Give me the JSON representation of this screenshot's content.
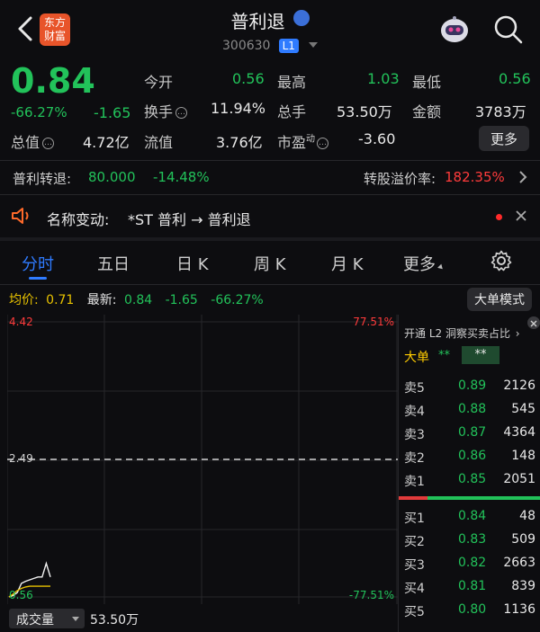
{
  "header": {
    "stock_name": "普利退",
    "badge_icon": "shield-badge-icon",
    "stock_code": "300630",
    "level_badge": "L1",
    "app_logo_line1": "东方",
    "app_logo_line2": "财富",
    "robot_icon": "robot-assistant-icon",
    "search_icon": "search-icon"
  },
  "quote": {
    "price": "0.84",
    "change_pct": "-66.27%",
    "change": "-1.65",
    "open_label": "今开",
    "open": "0.56",
    "high_label": "最高",
    "high": "1.03",
    "low_label": "最低",
    "low": "0.56",
    "turnover_label": "换手",
    "turnover": "11.94%",
    "volume_label": "总手",
    "volume": "53.50万",
    "amount_label": "金额",
    "amount": "3783万",
    "total_value_label": "总值",
    "total_value": "4.72亿",
    "float_label": "流值",
    "float_value": "3.76亿",
    "pe_label": "市盈",
    "pe_sup": "动",
    "pe": "-3.60",
    "more_label": "更多"
  },
  "bond": {
    "label": "普利转退:",
    "price": "80.000",
    "change": "-14.48%",
    "premium_label": "转股溢价率:",
    "premium": "182.35%"
  },
  "notice": {
    "label": "名称变动:",
    "text": "*ST 普利 → 普利退"
  },
  "tabs": [
    {
      "label": "分时"
    },
    {
      "label": "五日"
    },
    {
      "label": "日 K"
    },
    {
      "label": "周 K"
    },
    {
      "label": "月 K"
    },
    {
      "label": "更多"
    }
  ],
  "chart_info": {
    "avg_label": "均价:",
    "avg": "0.71",
    "latest_label": "最新:",
    "latest": "0.84",
    "change": "-1.65",
    "change_pct": "-66.27%",
    "big_order_mode": "大单模式"
  },
  "chart_data": {
    "type": "line",
    "y_top": "4.42",
    "y_mid": "2.49",
    "y_bottom": "0.56",
    "pct_top": "77.51%",
    "pct_bottom": "-77.51%",
    "ylim": [
      0.56,
      4.42
    ],
    "reference": 2.49,
    "series": [
      {
        "values": [
          0.56,
          0.58,
          0.62,
          0.75,
          0.78,
          0.8,
          0.82,
          0.84,
          0.84,
          1.03,
          0.84
        ]
      },
      {
        "values": [
          0.56,
          0.6,
          0.65,
          0.68,
          0.7,
          0.71,
          0.71,
          0.71,
          0.71,
          0.71,
          0.71
        ]
      }
    ]
  },
  "volume_bar": {
    "label": "成交量",
    "value": "53.50万"
  },
  "order_book": {
    "banner": "开通 L2 洞察买卖占比",
    "big_order_label": "大单",
    "big_order_v1": "**",
    "big_order_v2": "**",
    "asks": [
      {
        "label": "卖5",
        "price": "0.89",
        "vol": "2126"
      },
      {
        "label": "卖4",
        "price": "0.88",
        "vol": "545"
      },
      {
        "label": "卖3",
        "price": "0.87",
        "vol": "4364"
      },
      {
        "label": "卖2",
        "price": "0.86",
        "vol": "148"
      },
      {
        "label": "卖1",
        "price": "0.85",
        "vol": "2051"
      }
    ],
    "bids": [
      {
        "label": "买1",
        "price": "0.84",
        "vol": "48"
      },
      {
        "label": "买2",
        "price": "0.83",
        "vol": "509"
      },
      {
        "label": "买3",
        "price": "0.82",
        "vol": "2663"
      },
      {
        "label": "买4",
        "price": "0.81",
        "vol": "839"
      },
      {
        "label": "买5",
        "price": "0.80",
        "vol": "1136"
      }
    ],
    "bid_ask_ratio": 0.2
  },
  "colors": {
    "up": "#ff3b3b",
    "down": "#22c25a",
    "accent": "#2f7bff"
  }
}
